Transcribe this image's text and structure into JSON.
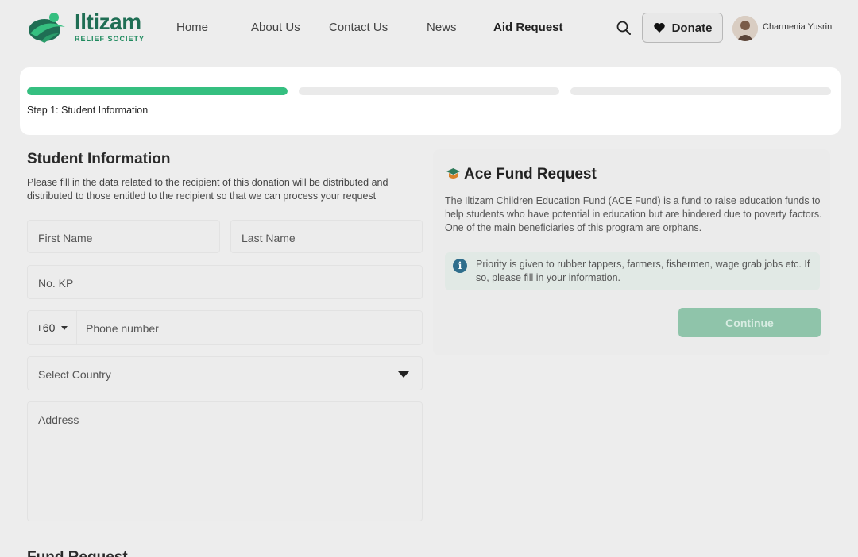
{
  "brand": {
    "name": "Iltizam",
    "subtitle": "RELIEF SOCIETY",
    "color": "#1f6e54"
  },
  "nav": {
    "items": [
      {
        "label": "Home",
        "active": false
      },
      {
        "label": "About Us",
        "active": false
      },
      {
        "label": "Contact Us",
        "active": false
      },
      {
        "label": "News",
        "active": false
      },
      {
        "label": "Aid Request",
        "active": true
      }
    ]
  },
  "header": {
    "search_icon": "search-icon",
    "donate_label": "Donate",
    "donate_icon": "heart-icon",
    "user_name": "Charmenia Yusrin"
  },
  "progress": {
    "steps_total": 3,
    "current_step": 1,
    "step_fill": [
      1,
      0,
      0
    ],
    "step_label": "Step 1: Student Information",
    "accent": "#35bf80"
  },
  "form": {
    "title": "Student Information",
    "description": "Please fill in the data related to the recipient of this donation will be distributed and distributed to those entitled to the recipient so that we can process your request",
    "first_name_placeholder": "First Name",
    "last_name_placeholder": "Last Name",
    "ic_placeholder": "No. KP",
    "phone_code": "+60",
    "phone_placeholder": "Phone number",
    "country_placeholder": "Select Country",
    "address_placeholder": "Address",
    "next_section_title": "Fund Request"
  },
  "fund_panel": {
    "icon": "graduation-cap-icon",
    "title": "Ace Fund Request",
    "description": "The Iltizam Children Education Fund (ACE Fund) is a fund to raise education funds to help students who have potential in education but are hindered due to poverty factors. One of the main beneficiaries of this program are orphans.",
    "info_icon": "info-icon",
    "info_text": "Priority is given to rubber tappers, farmers, fishermen, wage grab jobs etc. If so, please fill in your information.",
    "continue_label": "Continue",
    "continue_color": "#8fc4aa"
  }
}
